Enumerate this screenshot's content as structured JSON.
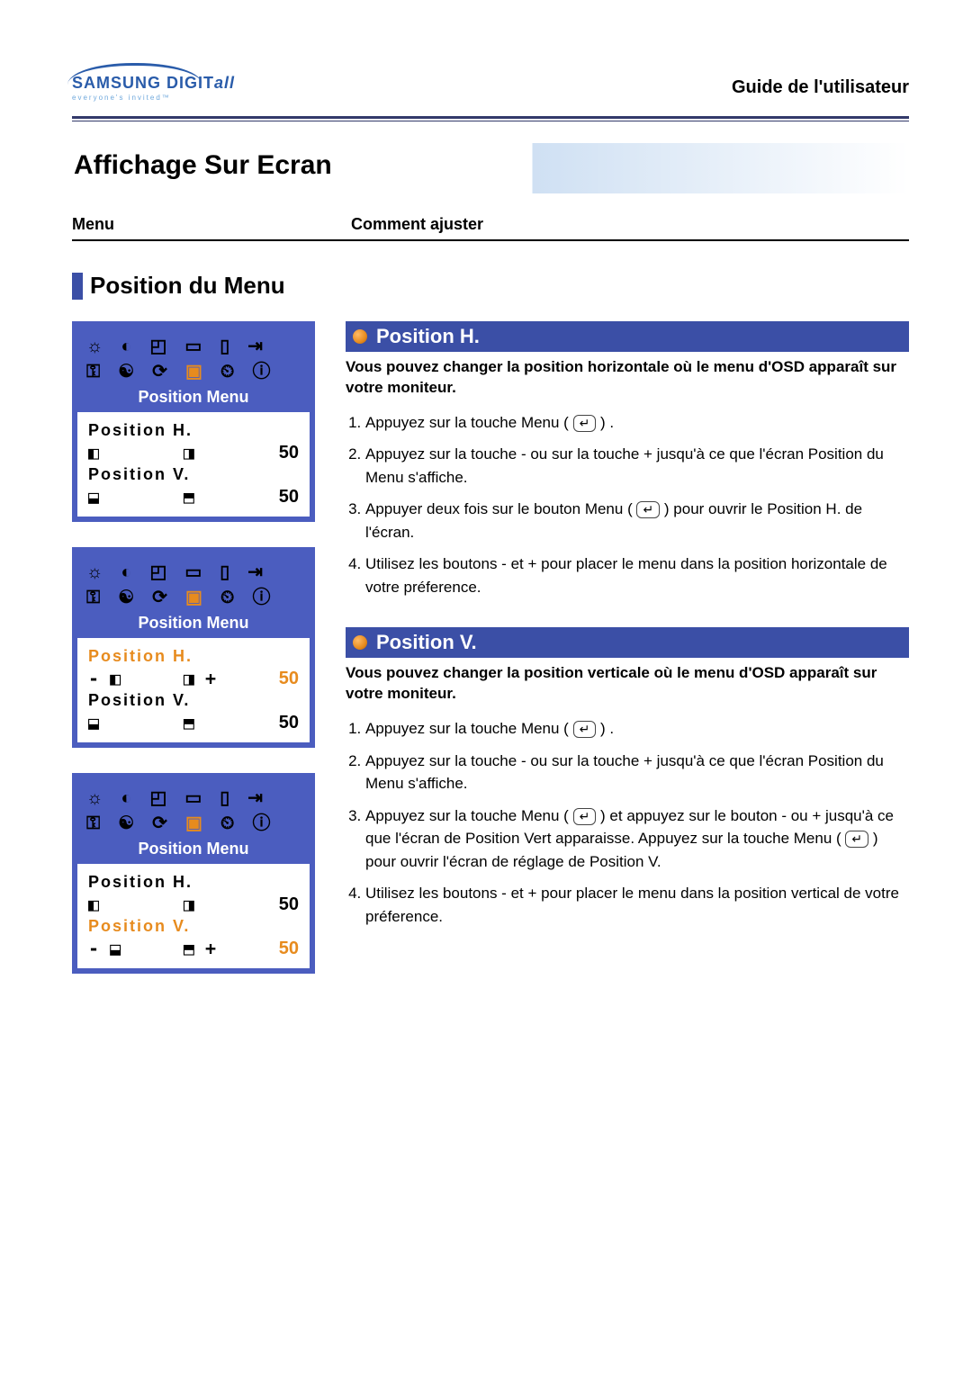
{
  "logo": {
    "brand": "SAMSUNG",
    "suffix_plain": " DIGIT",
    "suffix_italic": "all",
    "tagline": "everyone's invited™"
  },
  "header_right": "Guide de l'utilisateur",
  "page_title": "Affichage Sur Ecran",
  "cols": {
    "left": "Menu",
    "right": "Comment ajuster"
  },
  "section_title": "Position du Menu",
  "osd_title": "Position Menu",
  "osd": {
    "labels": {
      "h": "Position H.",
      "v": "Position V."
    },
    "values": {
      "h": "50",
      "v": "50"
    },
    "box1": {
      "active": "none"
    },
    "box2": {
      "active": "h"
    },
    "box3": {
      "active": "v"
    }
  },
  "posH": {
    "title": "Position H.",
    "desc": "Vous pouvez changer la position horizontale où le menu d'OSD apparaît sur votre moniteur.",
    "steps": {
      "s1a": "Appuyez sur la touche Menu ( ",
      "s1b": " ) .",
      "s2": "Appuyez sur la touche - ou sur la touche + jusqu'à ce que l'écran Position du Menu s'affiche.",
      "s3a": "Appuyer deux fois sur le bouton Menu ( ",
      "s3b": " ) pour ouvrir le Position H. de l'écran.",
      "s4": "Utilisez les boutons - et + pour placer le menu dans la position horizontale de votre préference."
    }
  },
  "posV": {
    "title": "Position V.",
    "desc": "Vous pouvez changer la position verticale où le menu d'OSD apparaît sur votre moniteur.",
    "steps": {
      "s1a": "Appuyez sur la touche Menu ( ",
      "s1b": " ) .",
      "s2": "Appuyez sur la touche - ou sur la touche + jusqu'à ce que l'écran Position du Menu s'affiche.",
      "s3a": "Appuyez sur la touche Menu ( ",
      "s3b": " ) et appuyez sur le bouton - ou + jusqu'à ce que l'écran de Position Vert apparaisse. Appuyez sur la touche Menu ( ",
      "s3c": " ) pour ouvrir l'écran de réglage de Position V.",
      "s4": "Utilisez les boutons - et + pour placer le menu dans la position vertical de votre préference."
    }
  },
  "menu_key_glyph": "↵"
}
